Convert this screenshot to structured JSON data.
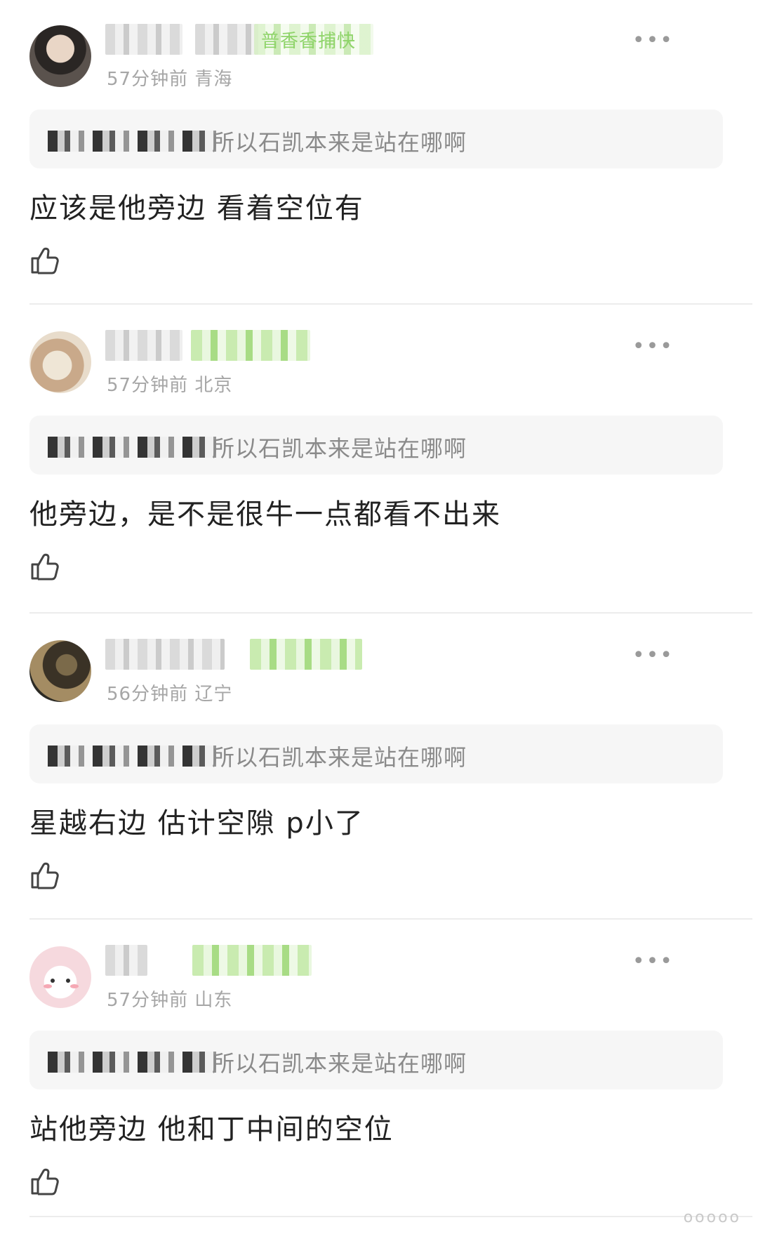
{
  "comments": [
    {
      "user_badge": "普香香捕快",
      "time": "57分钟前",
      "location": "青海",
      "quoted_text": "所以石凯本来是站在哪啊",
      "text": "应该是他旁边 看着空位有"
    },
    {
      "user_badge": "",
      "time": "57分钟前",
      "location": "北京",
      "quoted_text": "所以石凯本来是站在哪啊",
      "text": "他旁边，是不是很牛一点都看不出来"
    },
    {
      "user_badge": "",
      "time": "56分钟前",
      "location": "辽宁",
      "quoted_text": "所以石凯本来是站在哪啊",
      "text": "星越右边 估计空隙 p小了"
    },
    {
      "user_badge": "",
      "time": "57分钟前",
      "location": "山东",
      "quoted_text": "所以石凯本来是站在哪啊",
      "text": "站他旁边 他和丁中间的空位"
    }
  ],
  "more_icon": "•••",
  "like_icon": "thumbs-up-icon",
  "watermark": "ooooo"
}
